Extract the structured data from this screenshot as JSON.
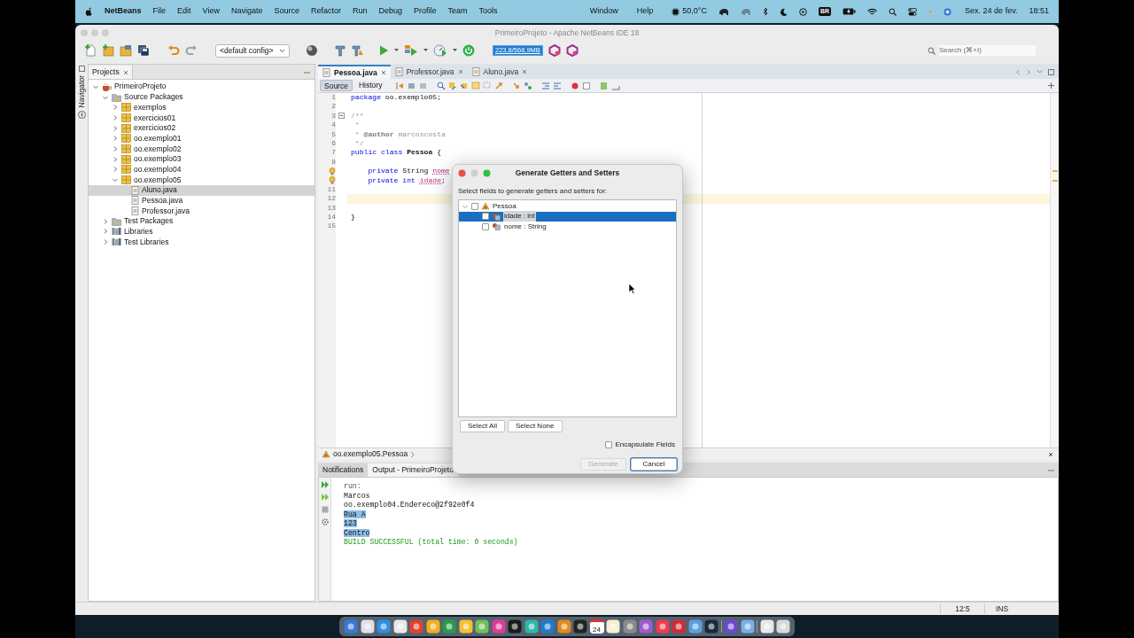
{
  "menu_bar": {
    "app_name": "NetBeans",
    "menus": [
      "File",
      "Edit",
      "View",
      "Navigate",
      "Source",
      "Refactor",
      "Run",
      "Debug",
      "Profile",
      "Team",
      "Tools"
    ],
    "right_menus": [
      "Window",
      "Help"
    ],
    "temperature": "50,0°C",
    "input_source": "BR",
    "date": "Sex. 24 de fev.",
    "time": "18:51"
  },
  "window": {
    "title": "PrimeiroProjeto - Apache NetBeans IDE 18"
  },
  "toolbar": {
    "config": "<default config>",
    "memory": "223,8/568,9MB",
    "search": {
      "placeholder": "Search (⌘+I)"
    }
  },
  "side_strip": {
    "label": "Navigator"
  },
  "projects": {
    "tab": "Projects",
    "tree": [
      {
        "label": "PrimeiroProjeto",
        "kind": "project",
        "expanded": true,
        "selected": false,
        "children": [
          {
            "label": "Source Packages",
            "kind": "folder",
            "expanded": true,
            "selected": false,
            "children": [
              {
                "label": "exemplos",
                "kind": "package",
                "expanded": false,
                "selected": false
              },
              {
                "label": "exercicios01",
                "kind": "package",
                "expanded": false,
                "selected": false
              },
              {
                "label": "exercicios02",
                "kind": "package",
                "expanded": false,
                "selected": false
              },
              {
                "label": "oo.exemplo01",
                "kind": "package",
                "expanded": false,
                "selected": false
              },
              {
                "label": "oo.exemplo02",
                "kind": "package",
                "expanded": false,
                "selected": false
              },
              {
                "label": "oo.exemplo03",
                "kind": "package",
                "expanded": false,
                "selected": false
              },
              {
                "label": "oo.exemplo04",
                "kind": "package",
                "expanded": false,
                "selected": false
              },
              {
                "label": "oo.exemplo05",
                "kind": "package",
                "expanded": true,
                "selected": false,
                "children": [
                  {
                    "label": "Aluno.java",
                    "kind": "file",
                    "selected": true
                  },
                  {
                    "label": "Pessoa.java",
                    "kind": "file",
                    "selected": false
                  },
                  {
                    "label": "Professor.java",
                    "kind": "file",
                    "selected": false
                  }
                ]
              }
            ]
          },
          {
            "label": "Test Packages",
            "kind": "folder",
            "expanded": false,
            "selected": false
          },
          {
            "label": "Libraries",
            "kind": "library",
            "expanded": false,
            "selected": false
          },
          {
            "label": "Test Libraries",
            "kind": "library",
            "expanded": false,
            "selected": false
          }
        ]
      }
    ]
  },
  "editor": {
    "tabs": [
      {
        "label": "Pessoa.java",
        "selected": true
      },
      {
        "label": "Professor.java",
        "selected": false
      },
      {
        "label": "Aluno.java",
        "selected": false
      }
    ],
    "views": [
      {
        "label": "Source",
        "selected": true
      },
      {
        "label": "History",
        "selected": false
      }
    ],
    "lines": [
      {
        "n": "1",
        "hint": false,
        "current": false,
        "fold": false,
        "code": [
          {
            "keyword": "package"
          },
          {
            "plain": " oo.exemplo05;"
          }
        ]
      },
      {
        "n": "2",
        "hint": false,
        "current": false,
        "fold": false
      },
      {
        "n": "3",
        "hint": false,
        "current": false,
        "fold": true,
        "code": [
          {
            "comment": "/**"
          }
        ]
      },
      {
        "n": "4",
        "hint": false,
        "current": false,
        "fold": false,
        "code": [
          {
            "comment": " *"
          }
        ]
      },
      {
        "n": "5",
        "hint": false,
        "current": false,
        "fold": false,
        "code": [
          {
            "comment": " * "
          },
          {
            "tag": "@author"
          },
          {
            "comment": " marcoscosta"
          }
        ]
      },
      {
        "n": "6",
        "hint": false,
        "current": false,
        "fold": false,
        "code": [
          {
            "comment": " */"
          }
        ]
      },
      {
        "n": "7",
        "hint": false,
        "current": false,
        "fold": false,
        "code": [
          {
            "keyword": "public class"
          },
          {
            "bold": " Pessoa"
          },
          {
            "plain": " {"
          }
        ]
      },
      {
        "n": "8",
        "hint": false,
        "current": false,
        "fold": false
      },
      {
        "hint": true,
        "current": false,
        "fold": false,
        "code": [
          {
            "keyword": "    private"
          },
          {
            "plain": " String "
          },
          {
            "field": "nome"
          }
        ]
      },
      {
        "hint": true,
        "current": false,
        "fold": false,
        "code": [
          {
            "keyword": "    private int "
          },
          {
            "field": "idade"
          },
          {
            "plain": ";"
          }
        ]
      },
      {
        "n": "11",
        "hint": false,
        "current": false,
        "fold": false
      },
      {
        "n": "12",
        "hint": false,
        "current": true,
        "fold": false
      },
      {
        "n": "13",
        "hint": false,
        "current": false,
        "fold": false
      },
      {
        "n": "14",
        "hint": false,
        "current": false,
        "fold": false,
        "code": [
          {
            "plain": "}"
          }
        ]
      },
      {
        "n": "15",
        "hint": false,
        "current": false,
        "fold": false
      }
    ],
    "breadcrumb": "oo.exemplo05.Pessoa"
  },
  "output": {
    "tabs": [
      {
        "label": "Notifications",
        "selected": false
      },
      {
        "label": "Output - PrimeiroProjeto",
        "selected": true
      }
    ],
    "lines": [
      {
        "text": "run:",
        "kind": "info",
        "selected": false
      },
      {
        "text": "Marcos",
        "kind": "plain",
        "selected": false
      },
      {
        "text": "oo.exemplo04.Endereco@2f92e0f4",
        "kind": "plain",
        "selected": false
      },
      {
        "text": "Rua A",
        "kind": "plain",
        "selected": true
      },
      {
        "text": "123",
        "kind": "plain",
        "selected": true
      },
      {
        "text": "Centro",
        "kind": "plain",
        "selected": true
      },
      {
        "text": "BUILD SUCCESSFUL (total time: 0 seconds)",
        "kind": "success",
        "selected": false
      }
    ]
  },
  "status_bar": {
    "position": "12:5",
    "mode": "INS"
  },
  "dialog": {
    "title": "Generate Getters and Setters",
    "prompt": "Select fields to generate getters and setters for:",
    "tree": {
      "label": "Pessoa",
      "checked": false,
      "expanded": true,
      "children": [
        {
          "label": "idade : int",
          "checked": false,
          "selected": true
        },
        {
          "label": "nome : String",
          "checked": false,
          "selected": false
        }
      ]
    },
    "buttons": [
      {
        "label": "Select All"
      },
      {
        "label": "Select None"
      }
    ],
    "encapsulate": {
      "label": "Encapsulate Fields",
      "checked": false
    },
    "actions": [
      {
        "label": "Generate",
        "disabled": true,
        "default": false
      },
      {
        "label": "Cancel",
        "disabled": false,
        "default": true
      }
    ]
  },
  "dock": {
    "calendar_day": "24"
  }
}
